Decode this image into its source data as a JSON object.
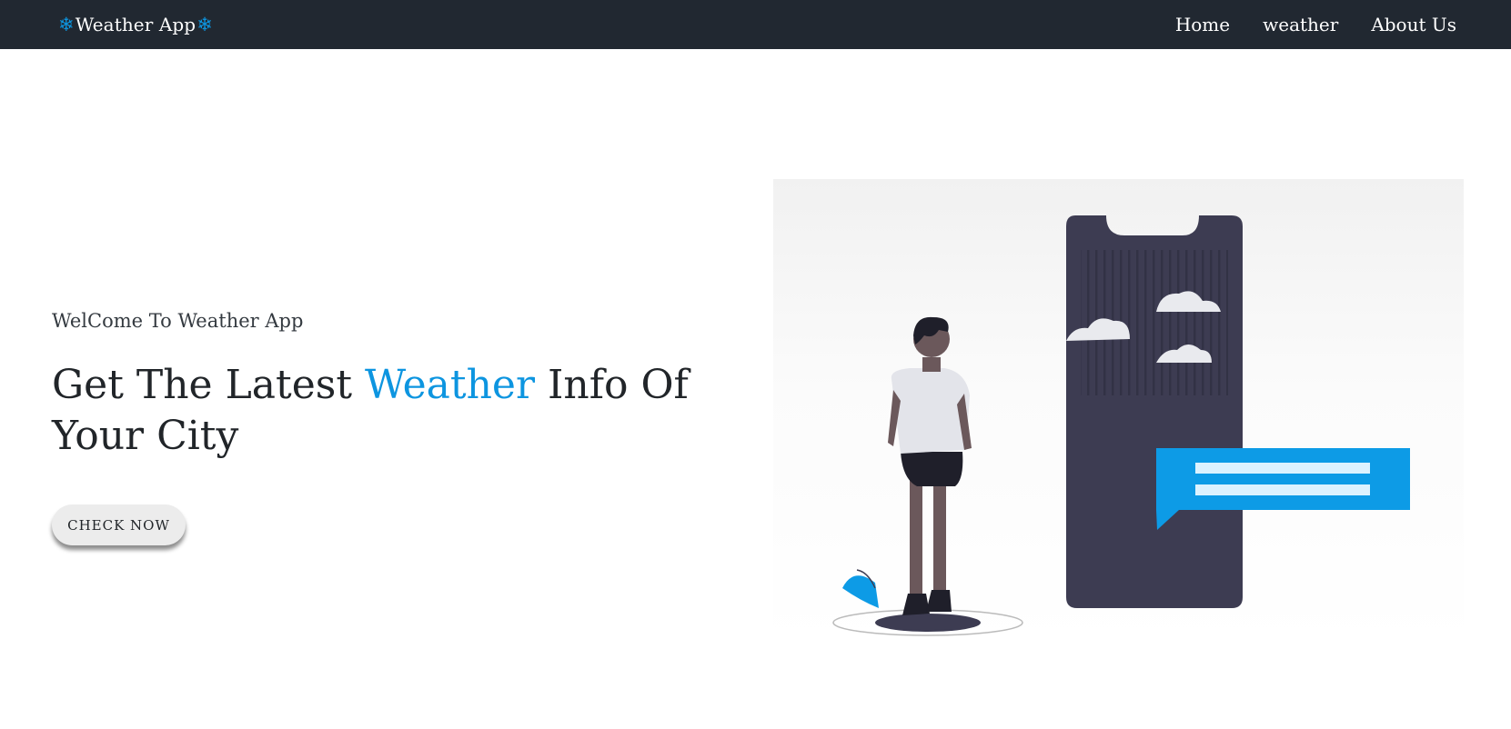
{
  "navbar": {
    "brand": {
      "icon": "snowflake-icon",
      "title": "Weather App",
      "icon_color": "#0d95e0"
    },
    "links": [
      {
        "label": "Home"
      },
      {
        "label": "weather"
      },
      {
        "label": "About Us"
      }
    ],
    "background": "#212831"
  },
  "hero": {
    "welcome": "WelCome To Weather App",
    "headline": {
      "before": "Get The Latest",
      "accent": "Weather",
      "after": "Info Of Your City"
    },
    "accent_color": "#0d95e0",
    "cta_label": "CHECK NOW",
    "illustration": "person-with-weather-phone-illustration"
  }
}
